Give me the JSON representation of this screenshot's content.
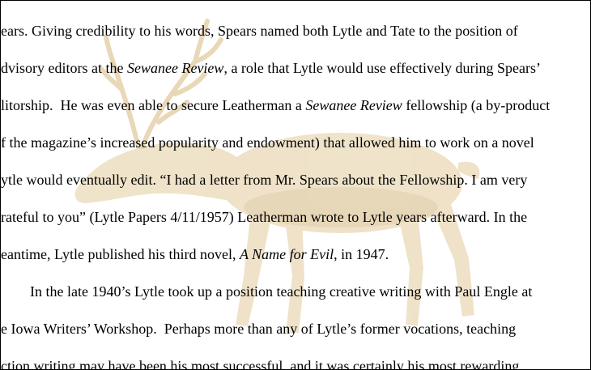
{
  "lines": [
    [
      {
        "t": "ears. Giving credibility to his words, Spears named both Lytle and Tate to the position of"
      }
    ],
    [
      {
        "t": "dvisory editors at the "
      },
      {
        "t": "Sewanee Review",
        "i": true
      },
      {
        "t": ", a role that Lytle would use effectively during Spears’"
      }
    ],
    [
      {
        "t": "litorship.  He was even able to secure Leatherman a "
      },
      {
        "t": "Sewanee Review",
        "i": true
      },
      {
        "t": " fellowship (a by-product"
      }
    ],
    [
      {
        "t": "f the magazine’s increased popularity and endowment) that allowed him to work on a novel"
      }
    ],
    [
      {
        "t": "ytle would eventually edit. “I had a letter from Mr. Spears about the Fellowship. I am very"
      }
    ],
    [
      {
        "t": "rateful to you” (Lytle Papers 4/11/1957) Leatherman wrote to Lytle years afterward. In the"
      }
    ],
    [
      {
        "t": "eantime, Lytle published his third novel, "
      },
      {
        "t": "A Name for Evil",
        "i": true
      },
      {
        "t": ", in 1947."
      }
    ],
    [
      {
        "t": "        In the late 1940’s Lytle took up a position teaching creative writing with Paul Engle at"
      }
    ],
    [
      {
        "t": "e Iowa Writers’ Workshop.  Perhaps more than any of Lytle’s former vocations, teaching"
      }
    ],
    [
      {
        "t": "ction writing may have been his most successful, and it was certainly his most rewarding."
      }
    ]
  ]
}
